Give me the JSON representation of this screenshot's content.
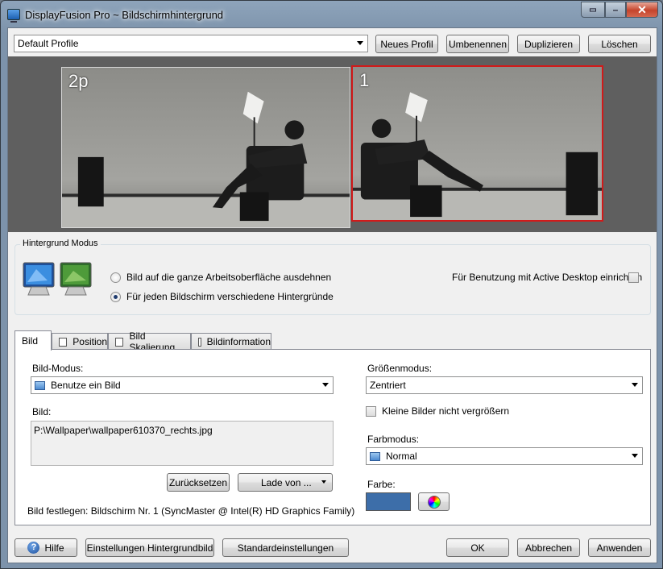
{
  "window": {
    "title": "DisplayFusion Pro ~ Bildschirmhintergrund",
    "close_glyph": "✕",
    "min_glyph": "–",
    "extra_glyph": "▭"
  },
  "profile": {
    "selected": "Default Profile",
    "buttons": {
      "new": "Neues Profil",
      "rename": "Umbenennen",
      "duplicate": "Duplizieren",
      "delete": "Löschen"
    }
  },
  "preview": {
    "monitors": [
      {
        "label": "2p",
        "selected": false
      },
      {
        "label": "1",
        "selected": true
      }
    ],
    "selected_color": "#d11a1a"
  },
  "background_mode": {
    "title": "Hintergrund Modus",
    "options": [
      {
        "label": "Bild auf die ganze Arbeitsoberfläche ausdehnen",
        "selected": false
      },
      {
        "label": "Für jeden Bildschirm verschiedene Hintergründe",
        "selected": true
      }
    ],
    "active_desktop_label": "Für Benutzung mit Active Desktop einrichten"
  },
  "tabs": [
    {
      "label": "Bild",
      "active": true
    },
    {
      "label": "Position",
      "active": false
    },
    {
      "label": "Bild Skalierung",
      "active": false
    },
    {
      "label": "Bildinformation",
      "active": false
    }
  ],
  "bild_tab": {
    "bild_modus_label": "Bild-Modus:",
    "bild_modus_value": "Benutze ein Bild",
    "bild_label": "Bild:",
    "bild_path": "P:\\Wallpaper\\wallpaper610370_rechts.jpg",
    "reset_button": "Zurücksetzen",
    "load_button": "Lade von ...",
    "status_text": "Bild festlegen: Bildschirm Nr. 1 (SyncMaster @ Intel(R) HD Graphics Family)",
    "groessenmodus_label": "Größenmodus:",
    "groessenmodus_value": "Zentriert",
    "small_images_label": "Kleine Bilder nicht vergrößern",
    "farbmodus_label": "Farbmodus:",
    "farbmodus_value": "Normal",
    "farbe_label": "Farbe:",
    "farbe_value": "#3d6ea9"
  },
  "footer": {
    "help": "Hilfe",
    "settings": "Einstellungen Hintergrundbild",
    "defaults": "Standardeinstellungen",
    "ok": "OK",
    "cancel": "Abbrechen",
    "apply": "Anwenden"
  }
}
